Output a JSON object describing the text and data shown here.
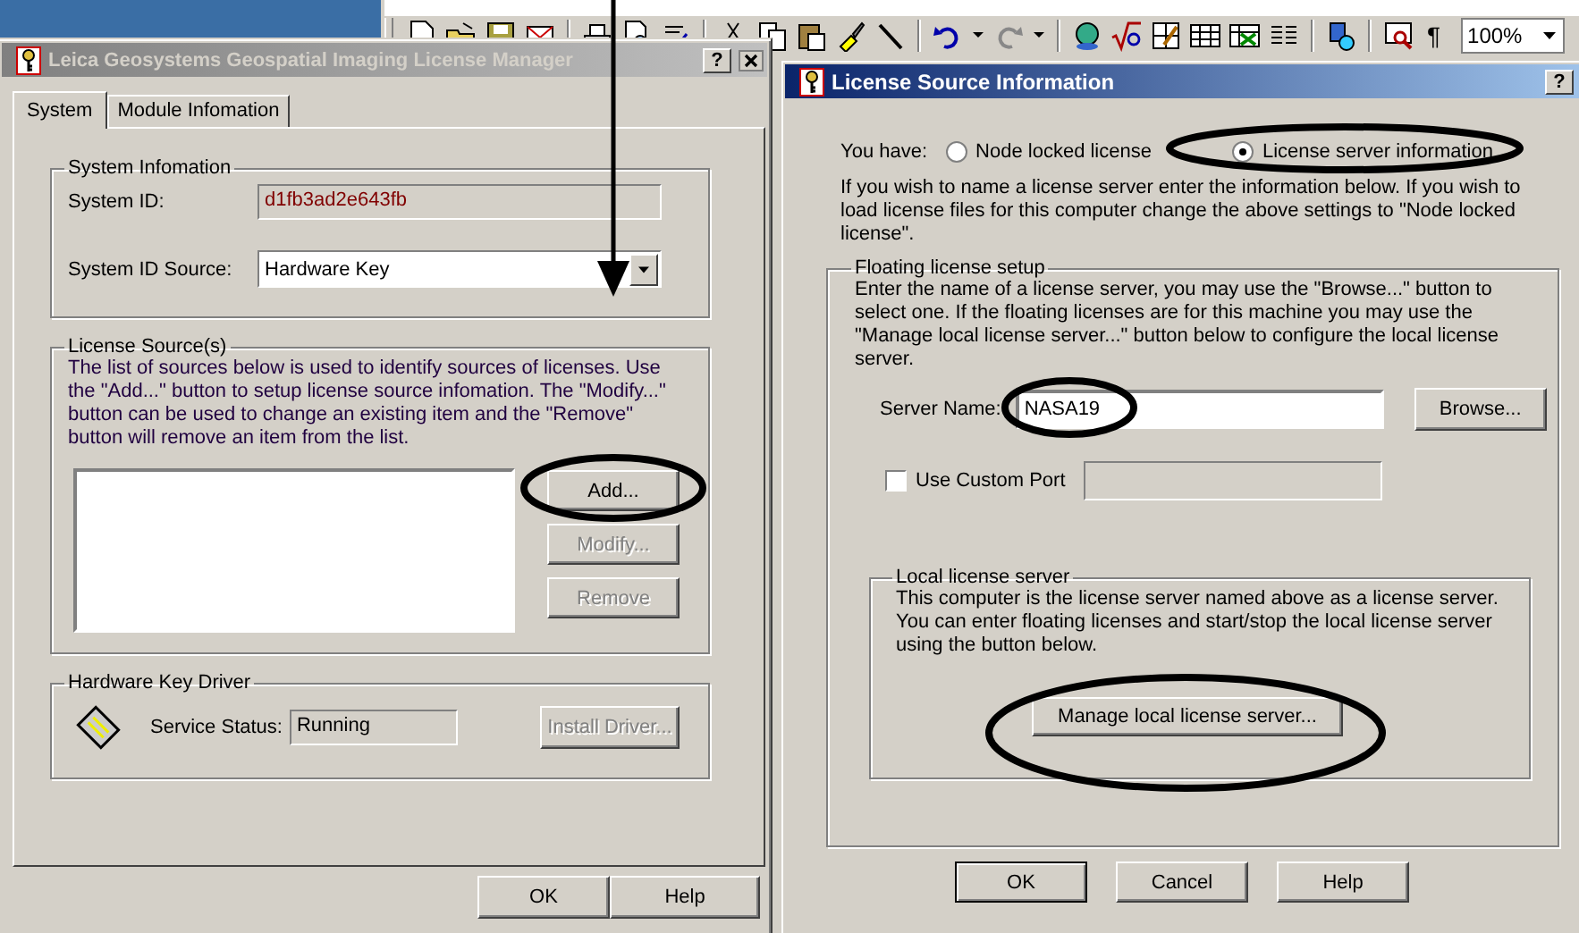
{
  "toolbar": {
    "mark_button": "¶",
    "zoom": "100%"
  },
  "license_manager": {
    "title": "Leica Geosystems Geospatial Imaging License Manager",
    "active": false,
    "help_button": "?",
    "tabs": [
      {
        "label": "System",
        "selected": true
      },
      {
        "label": "Module Infomation",
        "selected": false
      }
    ],
    "system_information": {
      "legend": "System Infomation",
      "system_id_label": "System ID:",
      "system_id": "d1fb3ad2e643fb",
      "source_label": "System ID Source:",
      "source": "Hardware Key"
    },
    "license_sources": {
      "legend": "License Source(s)",
      "description": "The list of sources below is used to identify sources of licenses. Use the \"Add...\" button to setup license source infomation. The \"Modify...\" button can be used to change an existing item and the \"Remove\" button will remove an item from the list.",
      "buttons": [
        {
          "label": "Add...",
          "disabled": false
        },
        {
          "label": "Modify...",
          "disabled": true
        },
        {
          "label": "Remove",
          "disabled": true
        }
      ]
    },
    "hardware_key_driver": {
      "legend": "Hardware Key Driver",
      "status_label": "Service Status:",
      "status": "Running",
      "button": {
        "label": "Install Driver...",
        "disabled": true
      }
    },
    "buttons": [
      "OK",
      "Help"
    ]
  },
  "license_source_dialog": {
    "title": "License Source Information",
    "active": true,
    "help_button": "?",
    "you_have_label": "You have:",
    "options": [
      {
        "label": "Node locked license",
        "selected": false
      },
      {
        "label": "License server information",
        "selected": true
      }
    ],
    "description": "If you wish to name a license server enter the information below. If you wish to load license files for this computer change the above settings to \"Node locked license\".",
    "floating": {
      "legend": "Floating license setup",
      "description": "Enter the name of a license server, you may use the \"Browse...\" button to select one. If the floating licenses are for this machine you may use the \"Manage local license server...\" button below to configure the local license server.",
      "server_name_label": "Server Name:",
      "server_name": "NASA19",
      "browse_button": "Browse...",
      "custom_port": {
        "label": "Use Custom Port",
        "checked": false
      }
    },
    "local_server": {
      "legend": "Local license server",
      "description": "This computer is the license server named above as a license server. You can enter floating licenses and start/stop the local license server using the button below.",
      "button": "Manage local license server..."
    },
    "buttons": [
      {
        "label": "OK",
        "default": true
      },
      {
        "label": "Cancel",
        "default": false
      },
      {
        "label": "Help",
        "default": false
      }
    ]
  }
}
